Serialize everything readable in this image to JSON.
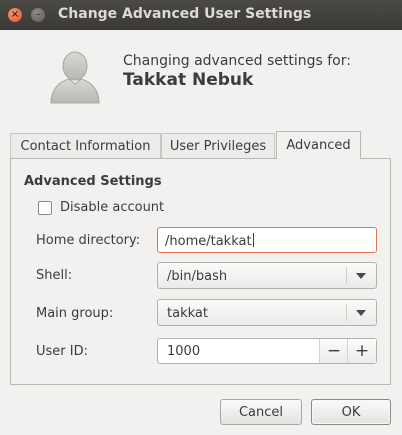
{
  "window": {
    "title": "Change Advanced User Settings"
  },
  "header": {
    "subtitle": "Changing advanced settings for:",
    "username": "Takkat Nebuk"
  },
  "tabs": [
    {
      "label": "Contact Information"
    },
    {
      "label": "User Privileges"
    },
    {
      "label": "Advanced",
      "active": true
    }
  ],
  "advanced": {
    "section_title": "Advanced Settings",
    "disable_account": {
      "label": "Disable account",
      "checked": false
    },
    "home_directory": {
      "label": "Home directory:",
      "value": "/home/takkat"
    },
    "shell": {
      "label": "Shell:",
      "value": "/bin/bash"
    },
    "main_group": {
      "label": "Main group:",
      "value": "takkat"
    },
    "user_id": {
      "label": "User ID:",
      "value": "1000"
    }
  },
  "buttons": {
    "cancel": "Cancel",
    "ok": "OK"
  },
  "icons": {
    "close": "close-icon",
    "minimize": "minimize-icon",
    "avatar": "user-avatar-icon",
    "dropdown": "chevron-down-icon",
    "decrement": "minus-icon",
    "increment": "plus-icon"
  },
  "colors": {
    "titlebar": "#3b3a36",
    "close_button": "#df4a16",
    "focus_border": "#e0764b",
    "window_bg": "#f2f1f0"
  }
}
